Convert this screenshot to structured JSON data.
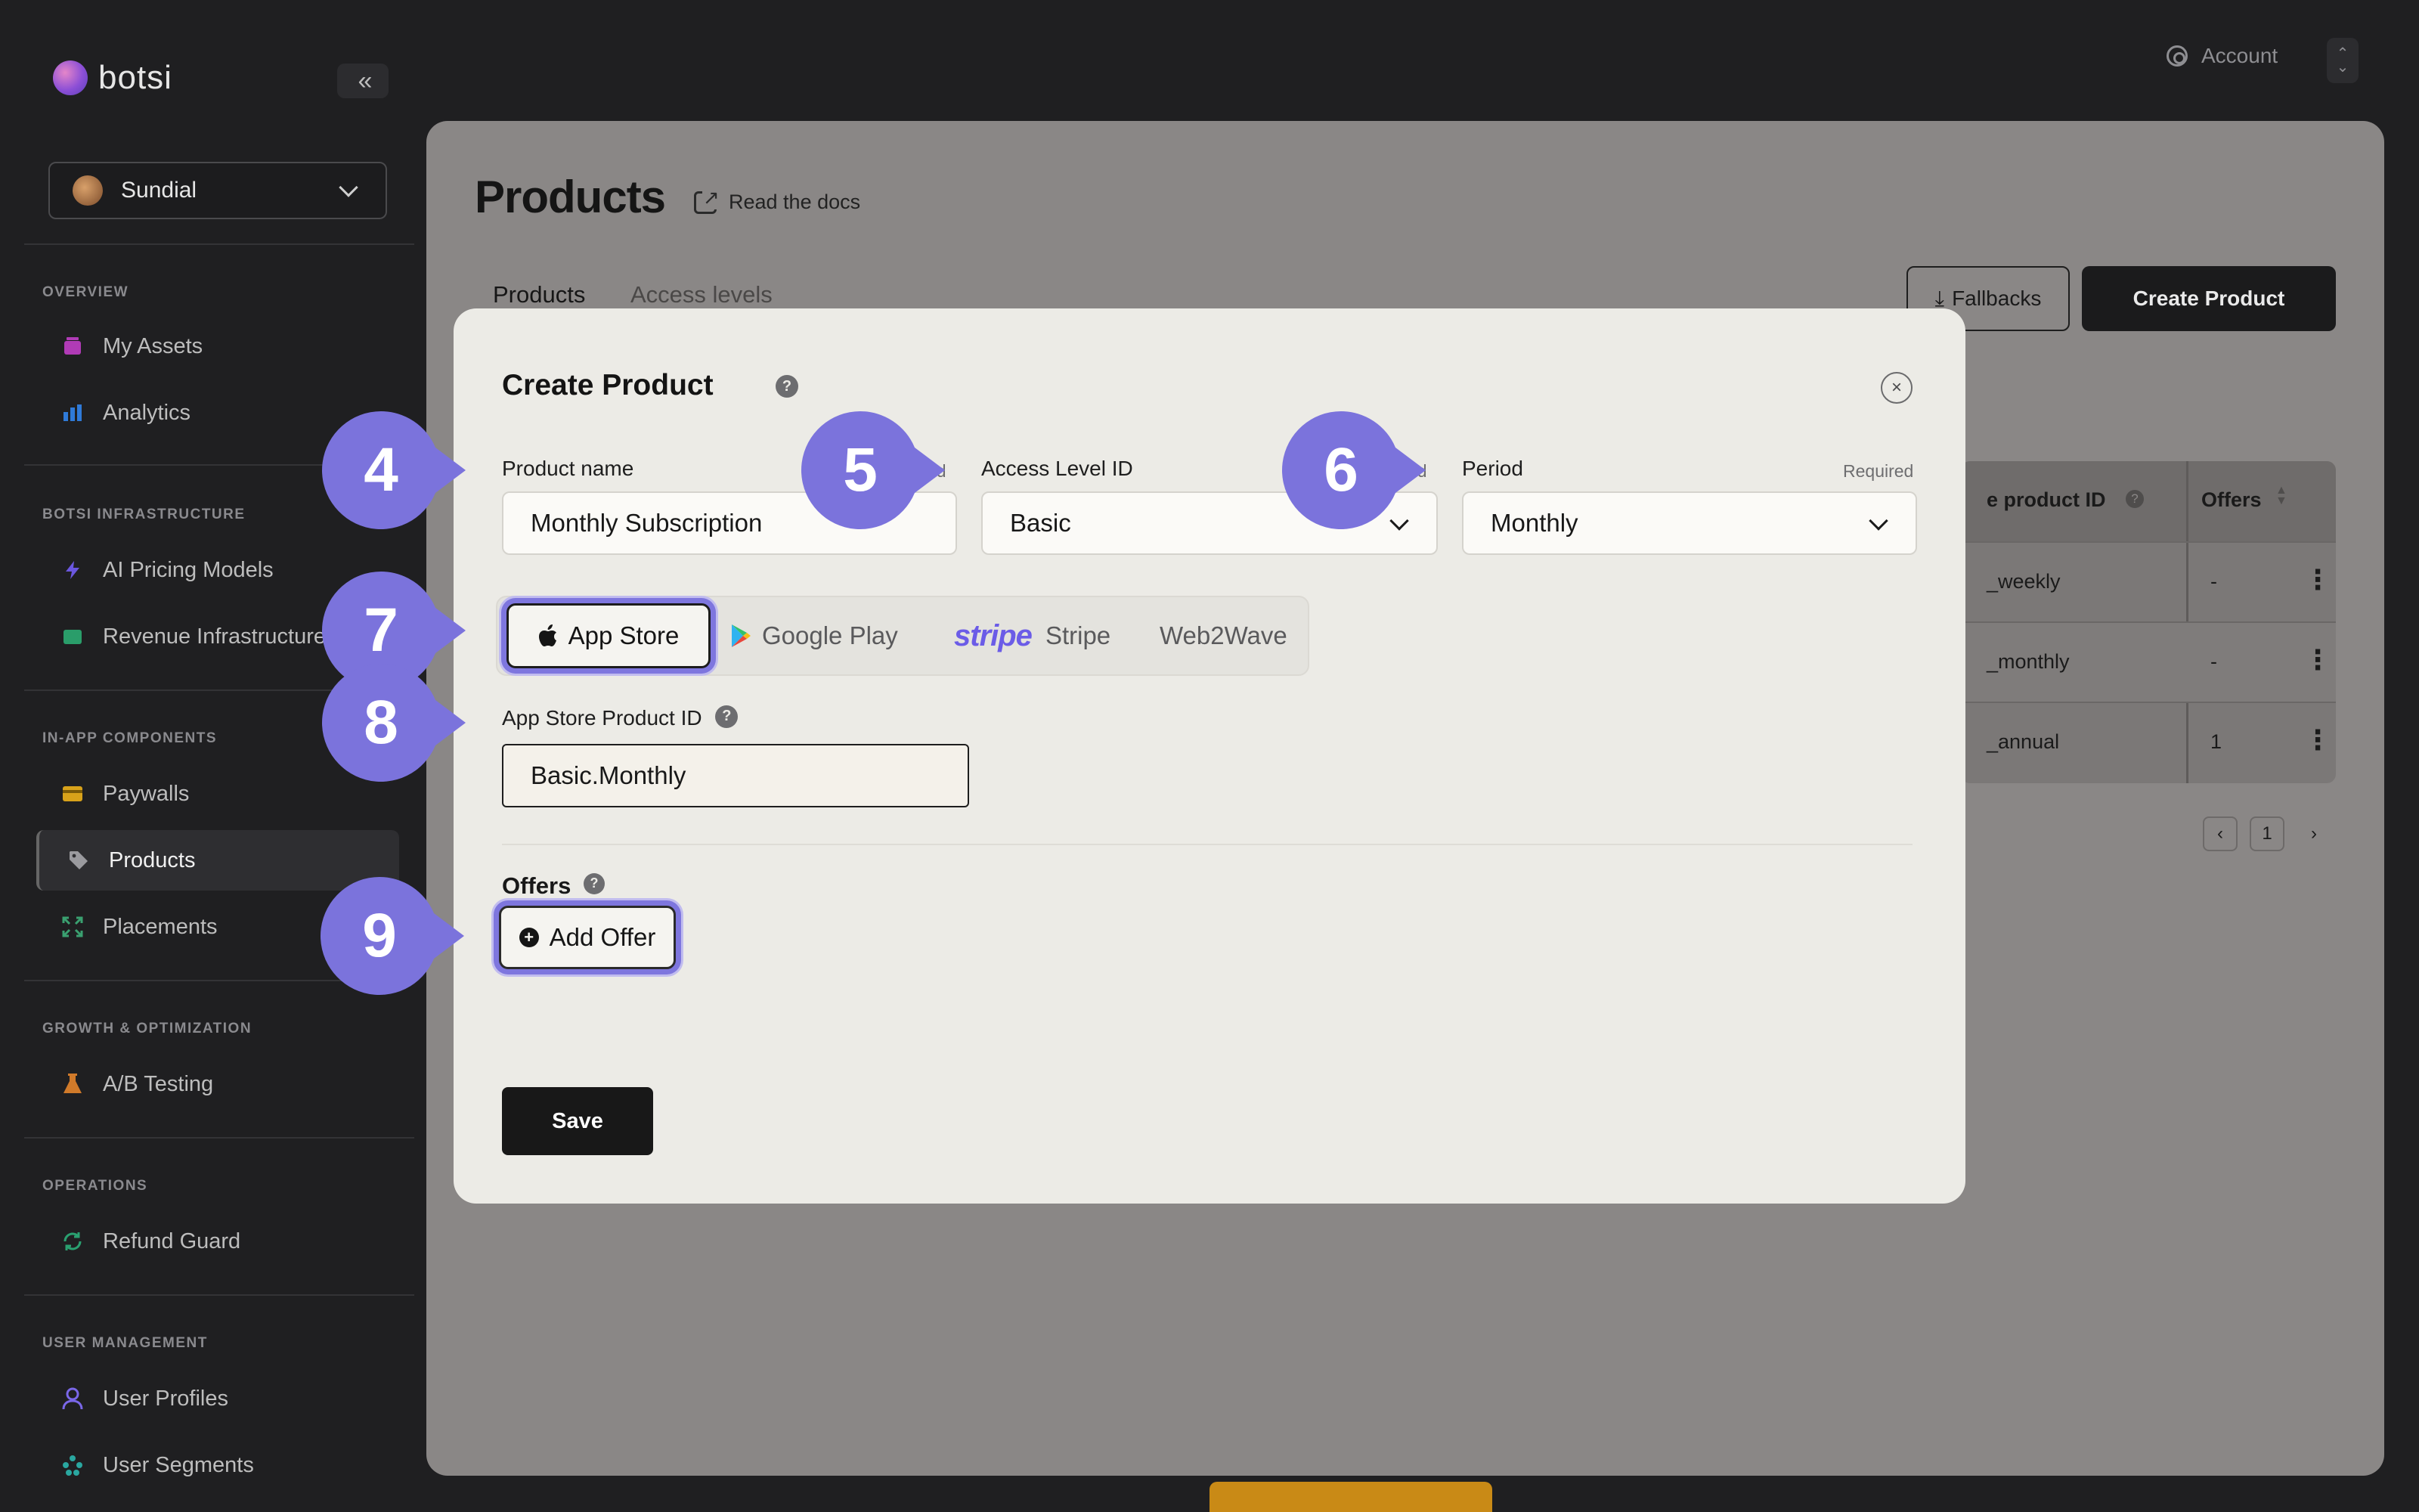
{
  "sidebar": {
    "brand": "botsi",
    "collapse_glyph": "«",
    "workspace": "Sundial",
    "sections": {
      "overview": "OVERVIEW",
      "infra": "BOTSI INFRASTRUCTURE",
      "inapp": "IN-APP COMPONENTS",
      "growth": "GROWTH & OPTIMIZATION",
      "ops": "OPERATIONS",
      "users": "USER MANAGEMENT"
    },
    "items": {
      "my_assets": "My Assets",
      "analytics": "Analytics",
      "ai_pricing": "AI Pricing Models",
      "revenue_infra": "Revenue Infrastructure",
      "paywalls": "Paywalls",
      "products": "Products",
      "placements": "Placements",
      "ab_testing": "A/B Testing",
      "refund_guard": "Refund Guard",
      "user_profiles": "User Profiles",
      "user_segments": "User Segments"
    },
    "active_item": "products",
    "accent_colors": {
      "my_assets": "#b03bb6",
      "analytics": "#2f7ad8",
      "ai_pricing": "#6b57e0",
      "revenue_infra": "#2a9d6a",
      "paywalls": "#d8a21a",
      "placements": "#3aa070",
      "ab_testing": "#d07a2a",
      "refund_guard": "#2aa070",
      "user_profiles": "#7a67e8",
      "user_segments": "#2aa7a0"
    }
  },
  "topbar": {
    "account_label": "Account"
  },
  "page": {
    "title": "Products",
    "docs_link": "Read the docs",
    "tabs": [
      "Products",
      "Access levels"
    ],
    "fallbacks_label": "Fallbacks",
    "create_label": "Create Product"
  },
  "table": {
    "headers": [
      "e product ID",
      "Offers"
    ],
    "rows": [
      {
        "id": "_weekly",
        "offers": "-"
      },
      {
        "id": "_monthly",
        "offers": "-"
      },
      {
        "id": "_annual",
        "offers": "1"
      }
    ],
    "pager": {
      "prev": "‹",
      "page": "1",
      "next": "›"
    }
  },
  "modal": {
    "title": "Create Product",
    "help_glyph": "?",
    "close_glyph": "×",
    "fields": {
      "product_name": {
        "label": "Product name",
        "required": "ed",
        "value": "Monthly Subscription"
      },
      "access_level": {
        "label": "Access Level ID",
        "required": "ed",
        "value": "Basic"
      },
      "period": {
        "label": "Period",
        "required": "Required",
        "value": "Monthly"
      }
    },
    "stores": [
      "App Store",
      "Google Play",
      "Stripe",
      "Web2Wave"
    ],
    "stripe_wordmark": "stripe",
    "selected_store": "App Store",
    "store_product_label": "App Store Product ID",
    "store_product_value": "Basic.Monthly",
    "offers_label": "Offers",
    "add_offer_label": "Add Offer",
    "save_label": "Save"
  },
  "callouts": [
    "4",
    "5",
    "6",
    "7",
    "8",
    "9"
  ],
  "colors": {
    "callout": "#7b73dc",
    "focus_ring": "#7e76de",
    "stripe": "#6b5ce7",
    "bottom_strip": "#c98a16"
  }
}
